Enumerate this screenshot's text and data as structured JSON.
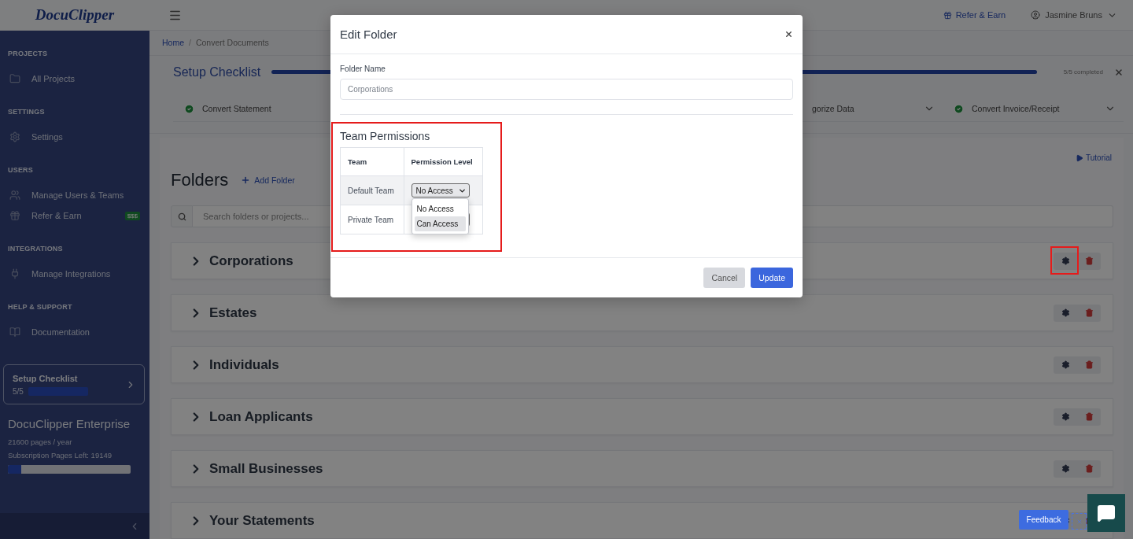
{
  "header": {
    "logo": "DocuClipper",
    "refer_link": "Refer & Earn",
    "user_name": "Jasmine Bruns"
  },
  "sidebar": {
    "sections": [
      {
        "title": "PROJECTS",
        "items": [
          {
            "label": "All Projects",
            "kind": "projects"
          }
        ]
      },
      {
        "title": "SETTINGS",
        "items": [
          {
            "label": "Settings",
            "kind": "settings"
          }
        ]
      },
      {
        "title": "USERS",
        "items": [
          {
            "label": "Manage Users & Teams",
            "kind": "users"
          },
          {
            "label": "Refer & Earn",
            "kind": "referral",
            "badge": "$$$"
          }
        ]
      },
      {
        "title": "INTEGRATIONS",
        "items": [
          {
            "label": "Manage Integrations",
            "kind": "integrations"
          }
        ]
      },
      {
        "title": "HELP & SUPPORT",
        "items": [
          {
            "label": "Documentation",
            "kind": "docs"
          }
        ]
      }
    ],
    "checklist": {
      "title": "Setup Checklist",
      "count": "5/5",
      "level": 1
    },
    "plan": {
      "name": "DocuClipper Enterprise",
      "quota": "21600 pages / year",
      "remaining": "Subscription Pages Left: 19149",
      "level": 0.11
    }
  },
  "breadcrumb": {
    "separator": "/",
    "items": [
      {
        "label": "Home",
        "current": false
      },
      {
        "label": "Convert Documents",
        "current": true
      }
    ]
  },
  "checklist": {
    "title": "Setup Checklist",
    "level": 1,
    "status": "5/5 completed",
    "items": [
      {
        "label": "Convert Statement",
        "done": true
      },
      {
        "label": "gorize Data"
      },
      {
        "label": "Convert Invoice/Receipt",
        "done": true
      }
    ]
  },
  "folders": {
    "title": "Folders",
    "add_label": "Add Folder",
    "tutorial": "Tutorial",
    "search_placeholder": "Search folders or projects...",
    "items": [
      {
        "name": "Corporations",
        "marked": true
      },
      {
        "name": "Estates",
        "marked": false
      },
      {
        "name": "Individuals",
        "marked": false
      },
      {
        "name": "Loan Applicants",
        "marked": false
      },
      {
        "name": "Small Businesses",
        "marked": false
      },
      {
        "name": "Your Statements",
        "marked": false
      }
    ]
  },
  "modal": {
    "title": "Edit Folder",
    "field_label": "Folder Name",
    "field_value": "Corporations",
    "section_title": "Team Permissions",
    "columns": [
      "Team",
      "Permission Level"
    ],
    "rows": [
      {
        "team": "Default Team",
        "value": "No Access",
        "open": true
      },
      {
        "team": "Private Team",
        "open": false
      }
    ],
    "options": [
      {
        "label": "No Access",
        "highlighted": false
      },
      {
        "label": "Can Access",
        "highlighted": true
      }
    ],
    "buttons": [
      {
        "label": "Cancel",
        "kind": "secondary"
      },
      {
        "label": "Update",
        "kind": "primary"
      }
    ]
  },
  "widgets": {
    "feedback": "Feedback"
  }
}
